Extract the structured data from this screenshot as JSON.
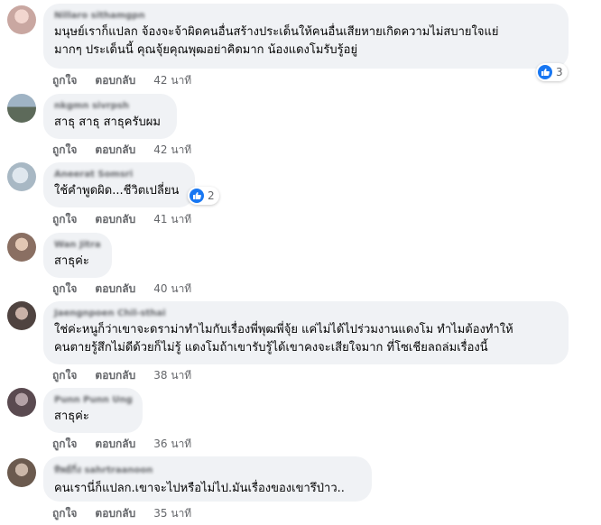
{
  "comments": [
    {
      "name": "Nillaro sithamgpn",
      "text_lines": [
        "มนุษย์เราก็แปลก จ้องจะจ้าผิดคนอื่นสร้างประเด็นให้คนอื่นเสียหายเกิดความไม่สบายใจแย่",
        "มากๆ ประเด็นนี้ คุณจุ้ยคุณพุฒอย่าคิดมาก น้องแดงโมรับรู้อยู่"
      ],
      "reaction_count": "3",
      "like_label": "ถูกใจ",
      "reply_label": "ตอบกลับ",
      "time": "42 นาที",
      "avatar_color": "#c9a7a1"
    },
    {
      "name": "nkgmn sivrpsh",
      "text_lines": [
        "สาธุ สาธุ สาธุครับผม"
      ],
      "reaction_count": "",
      "like_label": "ถูกใจ",
      "reply_label": "ตอบกลับ",
      "time": "42 นาที",
      "avatar_color": "#6f7c87"
    },
    {
      "name": "Aneerat Somsri",
      "text_lines": [
        "ใช้คำพูดผิด...ชีวิตเปลี่ยน"
      ],
      "reaction_count": "2",
      "like_label": "ถูกใจ",
      "reply_label": "ตอบกลับ",
      "time": "41 นาที",
      "avatar_color": "#a8b8c4"
    },
    {
      "name": "Wan Jitra",
      "text_lines": [
        "สาธุค่ะ"
      ],
      "reaction_count": "",
      "like_label": "ถูกใจ",
      "reply_label": "ตอบกลับ",
      "time": "40 นาที",
      "avatar_color": "#b59a8a"
    },
    {
      "name": "Jaengnpoen Chil-sthai",
      "text_lines": [
        "ใช่ค่ะหนูก็ว่าเขาจะดราม่าทำไมกับเรื่องพี่พุฒพี่จุ้ย แค่ไม่ได้ไปร่วมงานแดงโม ทำไมต้องทำให้",
        "คนตายรู้สึกไม่ดีด้วยก็ไม่รู้ แดงโมถ้าเขารับรู้ได้เขาคงจะเสียใจมาก ที่โซเชียลถล่มเรื่องนี้"
      ],
      "reaction_count": "",
      "like_label": "ถูกใจ",
      "reply_label": "ตอบกลับ",
      "time": "38 นาที",
      "avatar_color": "#6a5a55"
    },
    {
      "name": "Punn Punn Ung",
      "text_lines": [
        "สาธุค่ะ"
      ],
      "reaction_count": "",
      "like_label": "ถูกใจ",
      "reply_label": "ตอบกลับ",
      "time": "36 นาที",
      "avatar_color": "#7d6b70"
    },
    {
      "name": "ทิพย์กิ่ง sahrtraanoon",
      "text_lines": [
        "คนเรานี่ก็แปลก.เขาจะไปหรือไม่ไป.มันเรื่องของเขารึป่าว.."
      ],
      "reaction_count": "",
      "like_label": "ถูกใจ",
      "reply_label": "ตอบกลับ",
      "time": "35 นาที",
      "avatar_color": "#8e7a6c"
    }
  ],
  "colors": {
    "bubble": "#f0f2f5",
    "meta": "#65676b",
    "like_blue": "#1877f2"
  }
}
